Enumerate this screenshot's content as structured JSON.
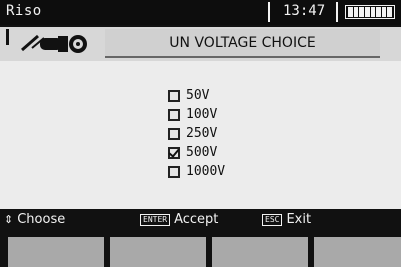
{
  "status_bar": {
    "mode": "Riso",
    "time": "13:47",
    "battery_icon": "battery-full-icon"
  },
  "header": {
    "icon": "insulation-probe-icon",
    "title": "UN VOLTAGE CHOICE"
  },
  "options": [
    {
      "label": "50V",
      "checked": false
    },
    {
      "label": "100V",
      "checked": false
    },
    {
      "label": "250V",
      "checked": false
    },
    {
      "label": "500V",
      "checked": true
    },
    {
      "label": "1000V",
      "checked": false
    }
  ],
  "hints": {
    "choose": {
      "key_icon": "up-down-arrows-icon",
      "label": "Choose"
    },
    "accept": {
      "key": "ENTER",
      "label": "Accept"
    },
    "exit": {
      "key": "ESC",
      "label": "Exit"
    }
  },
  "colors": {
    "background": "#111111",
    "panel": "#ececec",
    "header": "#d7d7d7",
    "softkey": "#a9a9a9"
  }
}
